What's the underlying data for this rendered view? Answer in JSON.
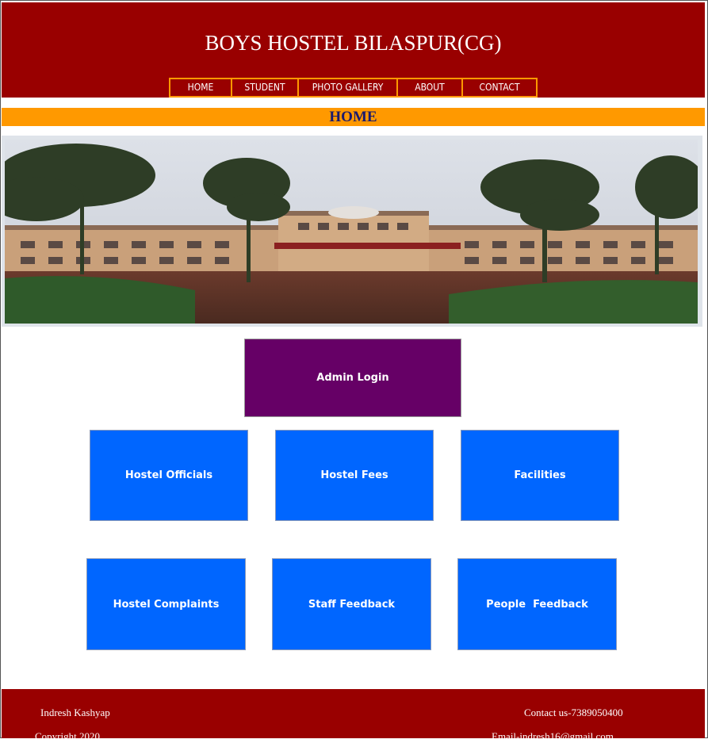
{
  "site": {
    "title": "BOYS HOSTEL BILASPUR(CG)"
  },
  "nav": [
    {
      "label": "HOME"
    },
    {
      "label": "STUDENT"
    },
    {
      "label": "PHOTO GALLERY"
    },
    {
      "label": "ABOUT"
    },
    {
      "label": "CONTACT"
    }
  ],
  "banner": {
    "title": "HOME"
  },
  "tiles": {
    "admin_login": "Admin Login",
    "hostel_officials": "Hostel Officials",
    "hostel_fees": "Hostel Fees",
    "facilities": "Facilities",
    "hostel_complaints": "Hostel Complaints",
    "staff_feedback": "Staff Feedback",
    "people_feedback": "People  Feedback"
  },
  "footer": {
    "name": "Indresh Kashyap",
    "contact": "Contact us-7389050400",
    "copyright": "Copyright 2020",
    "email": "Email-indresh16@gmail.com"
  },
  "colors": {
    "header_bg": "#990000",
    "accent_orange": "#ff9900",
    "admin_tile": "#660066",
    "tile_blue": "#0066ff",
    "banner_text": "#1a1a6e"
  }
}
